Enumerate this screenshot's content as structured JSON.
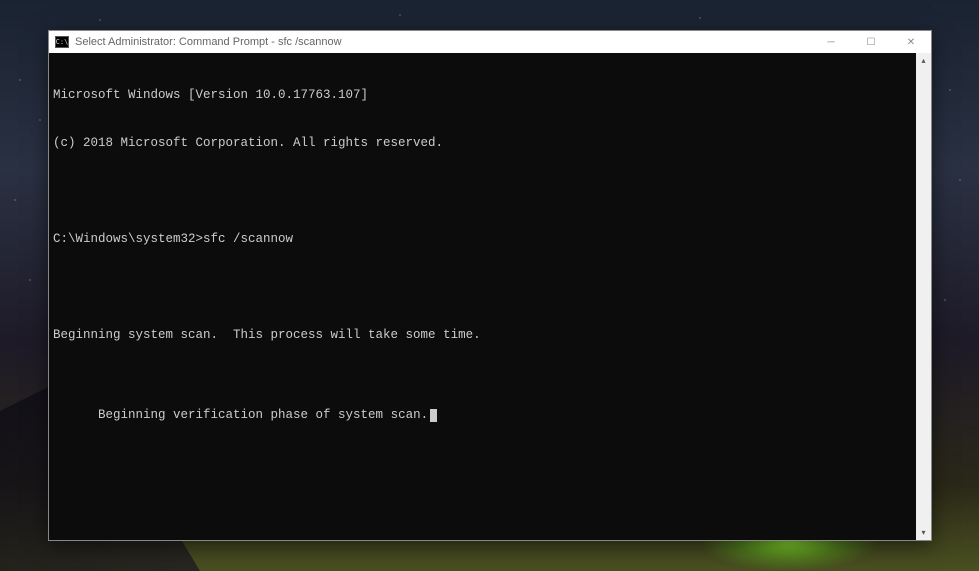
{
  "window": {
    "title": "Select Administrator: Command Prompt - sfc  /scannow",
    "icon_text": "C:\\"
  },
  "terminal": {
    "lines": [
      "Microsoft Windows [Version 10.0.17763.107]",
      "(c) 2018 Microsoft Corporation. All rights reserved.",
      "",
      "C:\\Windows\\system32>sfc /scannow",
      "",
      "Beginning system scan.  This process will take some time.",
      "",
      "Beginning verification phase of system scan."
    ]
  },
  "scrollbar": {
    "up": "▴",
    "down": "▾"
  },
  "controls": {
    "minimize": "─",
    "maximize": "☐",
    "close": "✕"
  }
}
